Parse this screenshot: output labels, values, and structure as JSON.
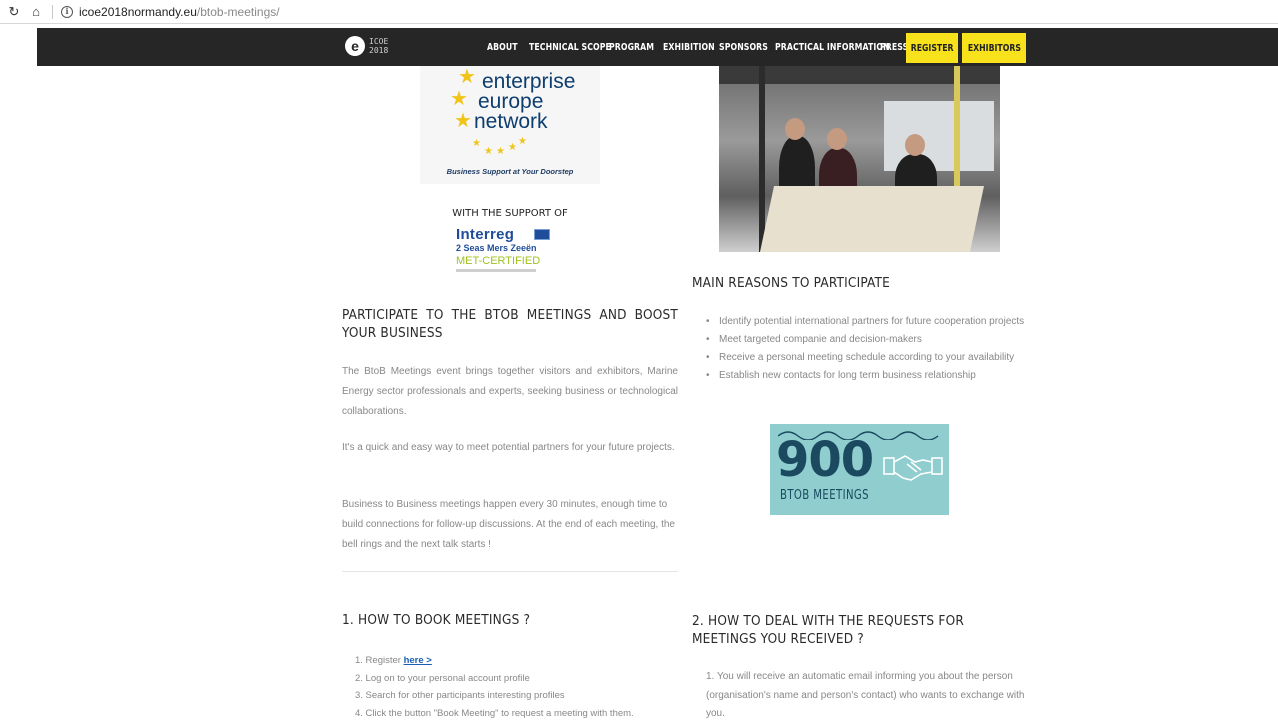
{
  "browser": {
    "url_host": "icoe2018normandy.eu",
    "url_path": "/btob-meetings/"
  },
  "nav": {
    "logo_text_top": "ICOE",
    "logo_text_bottom": "2018",
    "items": [
      "ABOUT",
      "TECHNICAL SCOPE",
      "PROGRAM",
      "EXHIBITION",
      "SPONSORS",
      "PRACTICAL INFORMATION",
      "PRESS"
    ],
    "register": "REGISTER",
    "exhibitors": "EXHIBITORS"
  },
  "een": {
    "line1": "enterprise",
    "line2": "europe",
    "line3": "network",
    "tagline": "Business Support at Your Doorstep"
  },
  "support": {
    "title": "WITH THE SUPPORT OF",
    "interreg": "Interreg",
    "interreg_sub": "2 Seas Mers Zeeën",
    "interreg_project": "MET-CERTIFIED"
  },
  "left": {
    "heading": "PARTICIPATE TO THE BTOB MEETINGS AND BOOST YOUR BUSINESS",
    "p1": "The BtoB Meetings event brings together visitors and exhibitors, Marine Energy sector professionals and experts, seeking business or technological collaborations.",
    "p2": "It's a quick and easy way to meet potential partners for your future projects.",
    "p3": "Business to Business meetings happen every 30 minutes, enough time to build connections for follow-up discussions. At the end of each meeting, the bell rings and the next talk starts !"
  },
  "right": {
    "heading": "MAIN REASONS TO PARTICIPATE",
    "reasons": [
      "Identify potential international partners for future cooperation projects",
      "Meet targeted companie and decision-makers",
      "Receive a personal meeting schedule according to your availability",
      "Establish new contacts for long term business relationship"
    ]
  },
  "badge": {
    "number": "900",
    "label": "BTOB MEETINGS"
  },
  "book": {
    "heading": "1. HOW TO BOOK MEETINGS ?",
    "step1_prefix": "1. Register ",
    "step1_link": "here >",
    "step2": "2. Log on to your personal account profile",
    "step3": "3. Search for other participants interesting profiles",
    "step4": "4. Click the button \"Book Meeting\" to request a meeting with them."
  },
  "requests": {
    "heading": "2. HOW TO DEAL WITH THE REQUESTS FOR MEETINGS YOU RECEIVED ?",
    "step1": "1. You will receive an automatic email informing you about the person (organisation's name and person's contact) who wants to exchange with you."
  },
  "colors": {
    "nav_bg": "#262626",
    "nav_highlight": "#f7e21b",
    "badge_bg": "#8fcdcf",
    "badge_text": "#1a4960"
  }
}
